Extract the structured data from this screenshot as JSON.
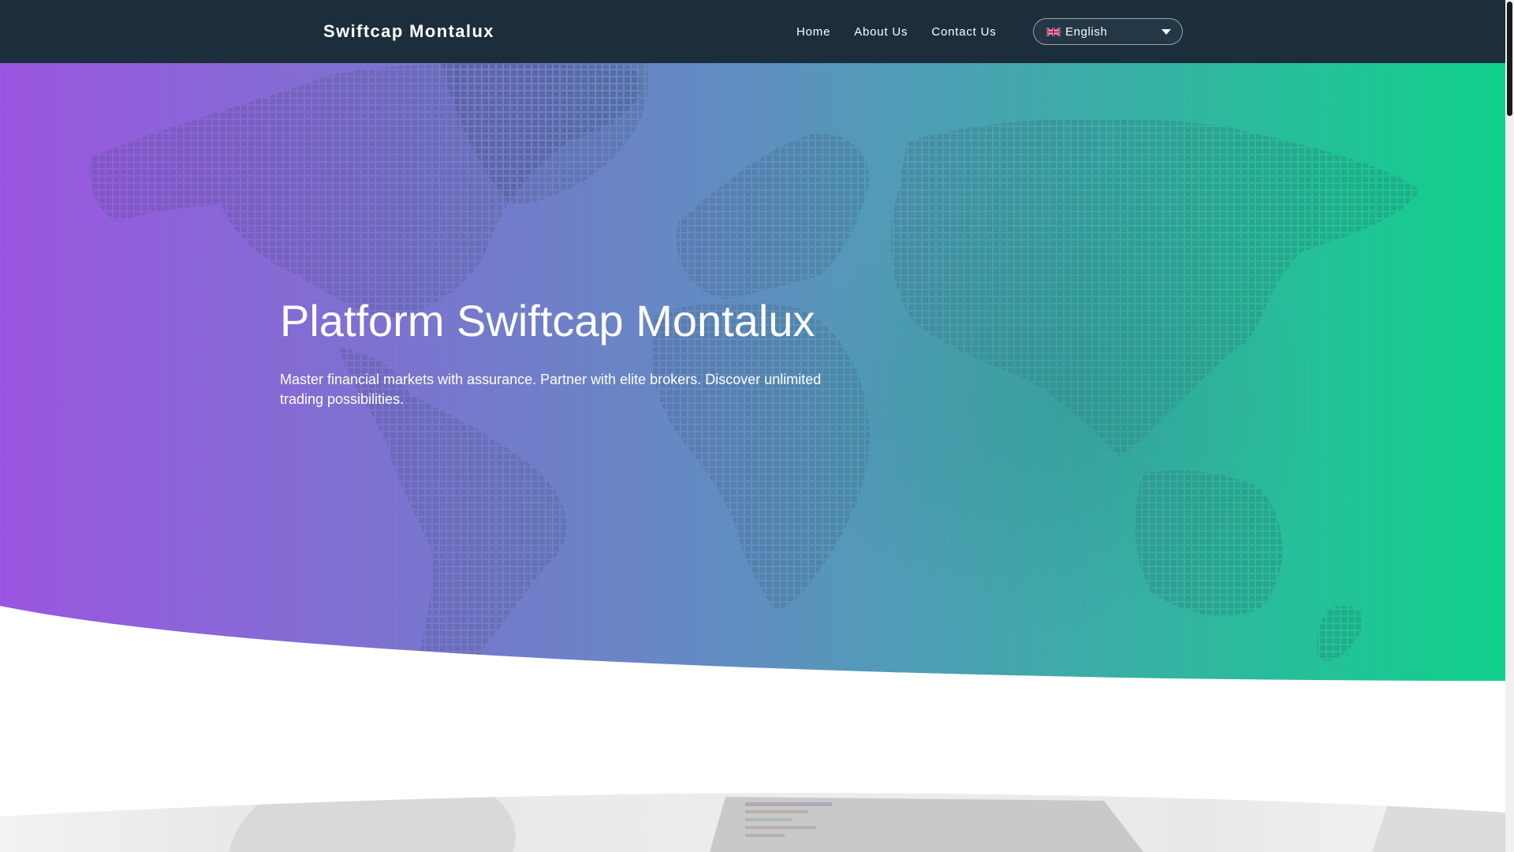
{
  "header": {
    "brand": "Swiftcap Montalux",
    "nav": [
      "Home",
      "About Us",
      "Contact Us"
    ],
    "language": {
      "selected": "English",
      "flag_icon": "uk-flag-icon"
    }
  },
  "hero": {
    "title": "Platform Swiftcap Montalux",
    "subtitle": "Master financial markets with assurance. Partner with elite brokers. Discover unlimited trading possibilities.",
    "gradient": {
      "start": "#9b55e0",
      "mid": "#5f8fc0",
      "end": "#10d18a"
    }
  },
  "colors": {
    "header_bg": "#1c2e3b",
    "text": "#ffffff",
    "page_bg": "#ffffff"
  }
}
